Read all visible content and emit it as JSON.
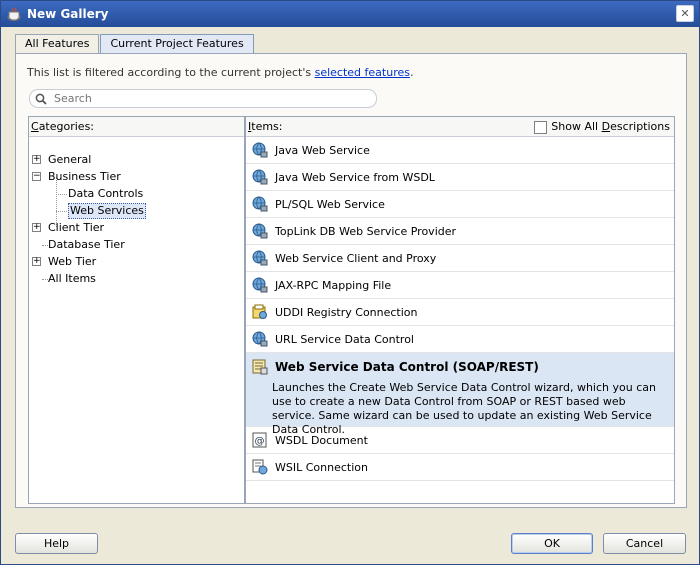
{
  "window": {
    "title": "New Gallery"
  },
  "tabs": [
    {
      "label": "All Features"
    },
    {
      "label": "Current Project Features"
    }
  ],
  "filter_note": {
    "text": "This list is filtered according to the current project's",
    "link": "selected features",
    "suffix": "."
  },
  "search": {
    "placeholder": "Search"
  },
  "categories": {
    "header_prefix": "C",
    "header_rest": "ategories:",
    "items": [
      {
        "label": "General"
      },
      {
        "label": "Business Tier"
      },
      {
        "label": "Data Controls"
      },
      {
        "label": "Web Services"
      },
      {
        "label": "Client Tier"
      },
      {
        "label": "Database Tier"
      },
      {
        "label": "Web Tier"
      },
      {
        "label": "All Items"
      }
    ]
  },
  "items_pane": {
    "header_prefix": "I",
    "header_rest": "tems:",
    "show_all_label_prefix": "Show All ",
    "show_all_label_u": "D",
    "show_all_label_rest": "escriptions",
    "items": [
      {
        "label": "Java Web Service",
        "icon": "globe-icon"
      },
      {
        "label": "Java Web Service from WSDL",
        "icon": "globe-icon"
      },
      {
        "label": "PL/SQL Web Service",
        "icon": "globe-icon"
      },
      {
        "label": "TopLink DB Web Service Provider",
        "icon": "globe-icon"
      },
      {
        "label": "Web Service Client and Proxy",
        "icon": "globe-icon"
      },
      {
        "label": "JAX-RPC Mapping File",
        "icon": "globe-icon"
      },
      {
        "label": "UDDI Registry Connection",
        "icon": "registry-icon"
      },
      {
        "label": "URL Service Data Control",
        "icon": "globe-icon"
      },
      {
        "label": "Web Service Data Control (SOAP/REST)",
        "icon": "data-control-icon",
        "description": "Launches the Create Web Service Data Control wizard, which you can use to create a new Data Control from SOAP or REST based web service. Same wizard can be used to update an existing Web Service Data Control."
      },
      {
        "label": "WSDL Document",
        "icon": "wsdl-icon"
      },
      {
        "label": "WSIL Connection",
        "icon": "wsil-icon"
      }
    ]
  },
  "buttons": {
    "help": "Help",
    "ok": "OK",
    "cancel": "Cancel"
  }
}
